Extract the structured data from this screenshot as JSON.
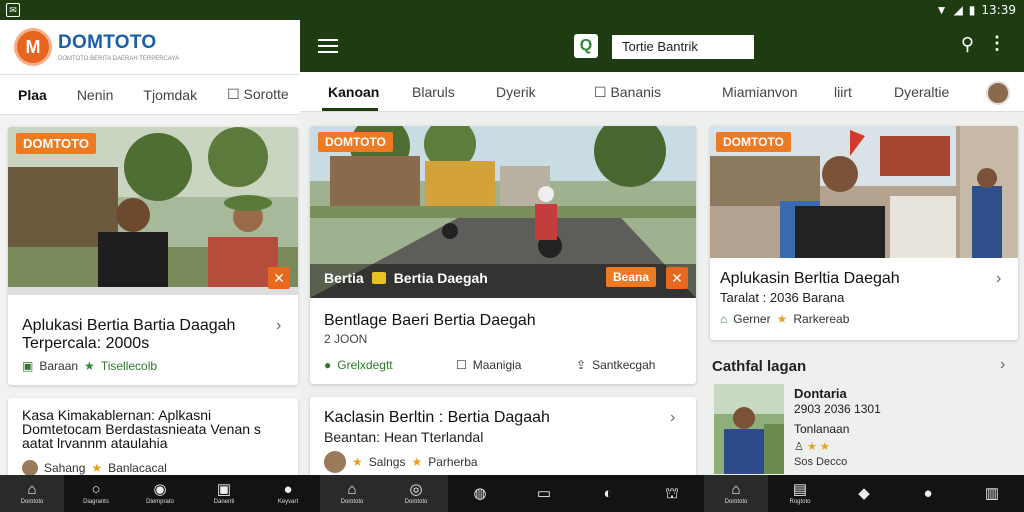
{
  "status": {
    "time": "13:39",
    "left_icon": "✉"
  },
  "left": {
    "logo": "DOMTOTO",
    "logo_letter": "M",
    "logo_sub": "DOMTOTO BERITA DAERAH TERPERCAYA",
    "tabs": [
      "Plaa",
      "Nenin",
      "Tjomdak",
      "Sorotte"
    ],
    "card1": {
      "badge": "DOMTOTO",
      "title": "Aplukasi Bertia Bartia Daagah Terpercala: 2000s",
      "meta1": "Baraan",
      "meta2": "Tisellecolb"
    },
    "card2": {
      "title": "Kasa Kimakablernan: Aplkasni Domtetocam Berdastasnieata Venan s aatat lrvannm ataulahia",
      "meta1": "Sahang",
      "meta2": "Banlacacal"
    }
  },
  "topbar": {
    "search_text": "Tortie Bantrik"
  },
  "tabs": [
    "Kanoan",
    "Blaruls",
    "Dyerik",
    "Bananis",
    "Miamianvon",
    "liirt",
    "Dyeraltie"
  ],
  "cards": {
    "hero": {
      "badge": "DOMTOTO",
      "overlay_title": "Bertia",
      "overlay_sub": "Bertia Daegah",
      "btn": "Beana",
      "title": "Bentlage Baeri Bertia Daegah",
      "sub": "2 JOON",
      "a1": "Grelxdegtt",
      "a2": "Maanigia",
      "a3": "Santkecgah"
    },
    "side": {
      "badge": "DOMTOTO",
      "title": "Aplukasin Berltia Daegah",
      "sub": "Taralat : 2036 Barana",
      "m1": "Gerner",
      "m2": "Rarkereab"
    },
    "side_section": "Cathfal lagan",
    "side_item": {
      "title": "Dontaria",
      "sub": "2903 2036 1301",
      "sub2": "Tonlanaan",
      "tail": "Sos Decco"
    },
    "bottom": {
      "title": "Kaclasin Berltin : Bertia Dagaah",
      "sub": "Beantan: Hean Tterlandal",
      "m1": "Salngs",
      "m2": "Parherba"
    }
  },
  "nav": [
    "Domtoto",
    "Diagrants",
    "Dlemprato",
    "Danenti",
    "Keyvart",
    "Domtoto",
    "Domtoto",
    "",
    "",
    "",
    "",
    "Domtoto",
    "Rogtoto",
    "",
    "",
    ""
  ],
  "colors": {
    "brand_green": "#1f3b12",
    "accent_orange": "#ee7a24",
    "icon_green": "#2e7a2a"
  }
}
